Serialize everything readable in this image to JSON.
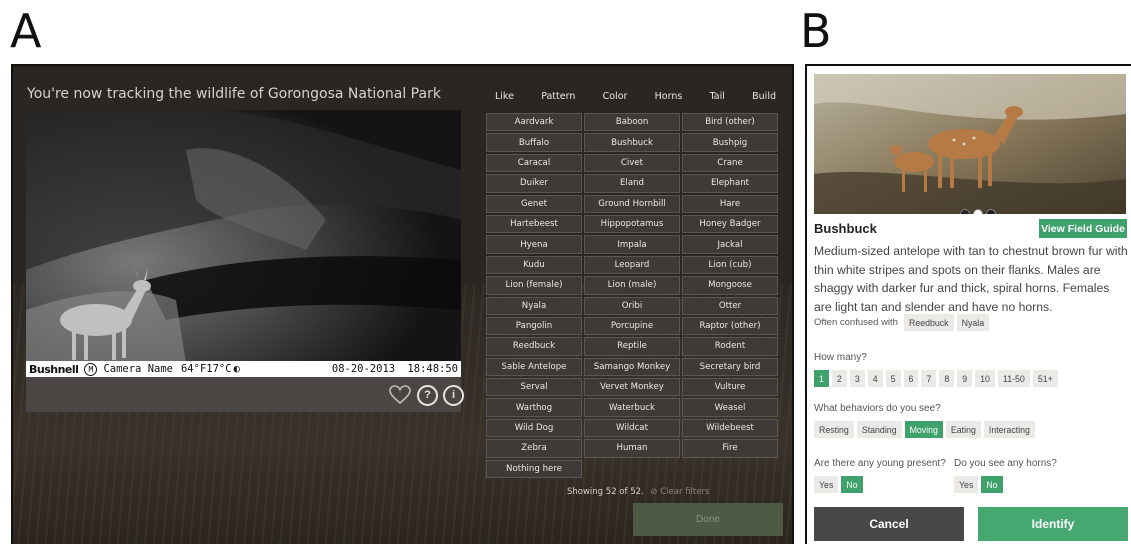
{
  "panel_labels": {
    "a": "A",
    "b": "B"
  },
  "panel_a": {
    "title": "You're now tracking the wildlife of Gorongosa National Park",
    "camera": {
      "brand": "Bushnell",
      "mode_letter": "M",
      "name": "Camera Name",
      "temperature": "64°F17°C",
      "date": "08-20-2013",
      "time": "18:48:50"
    },
    "filters": [
      "Like",
      "Pattern",
      "Color",
      "Horns",
      "Tail",
      "Build"
    ],
    "species": [
      "Aardvark",
      "Baboon",
      "Bird (other)",
      "Buffalo",
      "Bushbuck",
      "Bushpig",
      "Caracal",
      "Civet",
      "Crane",
      "Duiker",
      "Eland",
      "Elephant",
      "Genet",
      "Ground Hornbill",
      "Hare",
      "Hartebeest",
      "Hippopotamus",
      "Honey Badger",
      "Hyena",
      "Impala",
      "Jackal",
      "Kudu",
      "Leopard",
      "Lion (cub)",
      "Lion (female)",
      "Lion (male)",
      "Mongoose",
      "Nyala",
      "Oribi",
      "Otter",
      "Pangolin",
      "Porcupine",
      "Raptor (other)",
      "Reedbuck",
      "Reptile",
      "Rodent",
      "Sable Antelope",
      "Samango Monkey",
      "Secretary bird",
      "Serval",
      "Vervet Monkey",
      "Vulture",
      "Warthog",
      "Waterbuck",
      "Weasel",
      "Wild Dog",
      "Wildcat",
      "Wildebeest",
      "Zebra",
      "Human",
      "Fire",
      "Nothing here"
    ],
    "showing": "Showing 52 of 52.",
    "clear_filters": "Clear filters",
    "done_label": "Done"
  },
  "panel_b": {
    "species_name": "Bushbuck",
    "field_guide_label": "View Field Guide",
    "description": "Medium-sized antelope with tan to chestnut brown fur with thin white stripes and spots on their flanks. Males are shaggy with darker fur and thick, spiral horns. Females are light tan and slender and have no horns.",
    "confused_label": "Often confused with",
    "confused_with": [
      "Reedbuck",
      "Nyala"
    ],
    "how_many_label": "How many?",
    "how_many_options": [
      "1",
      "2",
      "3",
      "4",
      "5",
      "6",
      "7",
      "8",
      "9",
      "10",
      "11-50",
      "51+"
    ],
    "how_many_selected": "1",
    "behaviors_label": "What behaviors do you see?",
    "behaviors": [
      "Resting",
      "Standing",
      "Moving",
      "Eating",
      "Interacting"
    ],
    "behaviors_selected": "Moving",
    "young_label": "Are there any young present?",
    "young_options": [
      "Yes",
      "No"
    ],
    "young_selected": "No",
    "horns_label": "Do you see any horns?",
    "horns_options": [
      "Yes",
      "No"
    ],
    "horns_selected": "No",
    "cancel_label": "Cancel",
    "identify_label": "Identify"
  },
  "colors": {
    "accent_green": "#3fa16c",
    "dark_panel": "#2a2622",
    "chip_bg": "#eceae6",
    "cancel_bg": "#4a4846"
  }
}
